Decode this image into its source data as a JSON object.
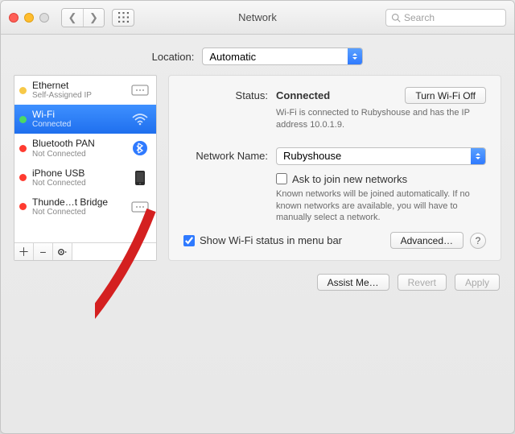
{
  "window": {
    "title": "Network",
    "search_placeholder": "Search"
  },
  "location": {
    "label": "Location:",
    "value": "Automatic"
  },
  "services": [
    {
      "name": "Ethernet",
      "sub": "Self-Assigned IP",
      "status": "yellow",
      "icon": "ethernet"
    },
    {
      "name": "Wi-Fi",
      "sub": "Connected",
      "status": "green",
      "icon": "wifi",
      "selected": true
    },
    {
      "name": "Bluetooth PAN",
      "sub": "Not Connected",
      "status": "red",
      "icon": "bluetooth"
    },
    {
      "name": "iPhone USB",
      "sub": "Not Connected",
      "status": "red",
      "icon": "phone"
    },
    {
      "name": "Thunde…t Bridge",
      "sub": "Not Connected",
      "status": "red",
      "icon": "ethernet"
    }
  ],
  "detail": {
    "status_label": "Status:",
    "status_value": "Connected",
    "turn_off_btn": "Turn Wi-Fi Off",
    "status_desc": "Wi-Fi is connected to Rubyshouse and has the IP address 10.0.1.9.",
    "network_name_label": "Network Name:",
    "network_name_value": "Rubyshouse",
    "ask_join_label": "Ask to join new networks",
    "ask_join_desc": "Known networks will be joined automatically. If no known networks are available, you will have to manually select a network.",
    "show_status_label": "Show Wi-Fi status in menu bar",
    "advanced_btn": "Advanced…"
  },
  "bottom": {
    "assist": "Assist Me…",
    "revert": "Revert",
    "apply": "Apply"
  }
}
